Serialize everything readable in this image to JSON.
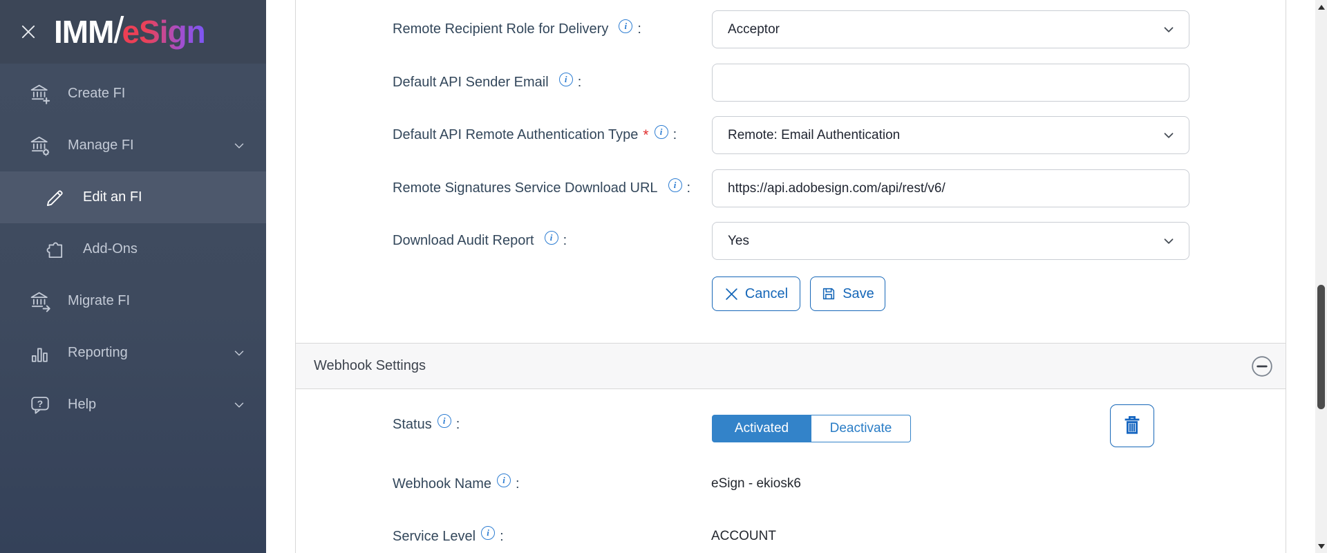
{
  "sidebar": {
    "logo": {
      "prefix": "IMM",
      "slash": "/",
      "suffix": "eSign"
    },
    "items": [
      {
        "label": "Create FI",
        "icon": "bank-plus-icon"
      },
      {
        "label": "Manage FI",
        "icon": "bank-gear-icon",
        "expandable": true
      },
      {
        "label": "Edit an FI",
        "icon": "pencil-icon",
        "sub": true,
        "active": true
      },
      {
        "label": "Add-Ons",
        "icon": "puzzle-icon",
        "sub": true
      },
      {
        "label": "Migrate FI",
        "icon": "bank-arrow-icon"
      },
      {
        "label": "Reporting",
        "icon": "bar-chart-icon",
        "expandable": true
      },
      {
        "label": "Help",
        "icon": "help-bubble-icon",
        "expandable": true
      }
    ]
  },
  "form": {
    "colon": ":",
    "rows": [
      {
        "label": "Remote Recipient Role for Delivery",
        "required": "",
        "type": "select",
        "value": "Acceptor"
      },
      {
        "label": "Default API Sender Email",
        "required": "",
        "type": "input",
        "value": ""
      },
      {
        "label": "Default API Remote Authentication Type",
        "required": "*",
        "type": "select",
        "value": "Remote: Email Authentication"
      },
      {
        "label": "Remote Signatures Service Download URL",
        "required": "",
        "type": "input",
        "value": "https://api.adobesign.com/api/rest/v6/"
      },
      {
        "label": "Download Audit Report",
        "required": "",
        "type": "select",
        "value": "Yes"
      }
    ],
    "buttons": {
      "cancel": "Cancel",
      "save": "Save"
    }
  },
  "webhook": {
    "title": "Webhook Settings",
    "status_label": "Status",
    "status_active": "Activated",
    "status_inactive": "Deactivate",
    "name_label": "Webhook Name",
    "name_value": "eSign - ekiosk6",
    "service_label": "Service Level",
    "service_value": "ACCOUNT"
  },
  "colors": {
    "accent_blue": "#1667b8",
    "toggle_active_blue": "#3383c9",
    "info_blue": "#2d7dd2",
    "required_red": "#e02f2f",
    "sidebar_bg": "#3e4a5e",
    "sidebar_header_bg": "#3c4657",
    "sidebar_active_bg": "#4d586c",
    "logo_gradient_start": "#ee3e53",
    "logo_gradient_end": "#7b57f5",
    "section_bar_bg": "#f7f7f8",
    "border_gray": "#d8d8d8"
  }
}
